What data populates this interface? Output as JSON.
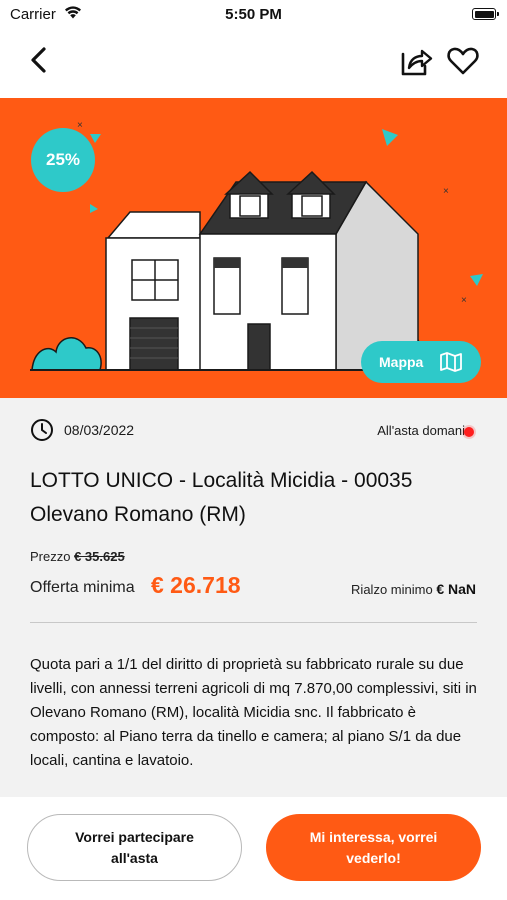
{
  "status_bar": {
    "carrier": "Carrier",
    "time": "5:50 PM",
    "icons": [
      "wifi-icon",
      "battery-icon"
    ]
  },
  "nav": {
    "icons": [
      "back-chevron-icon",
      "share-icon",
      "heart-icon"
    ]
  },
  "hero": {
    "discount": "25%",
    "map_label": "Mappa",
    "background_color": "#ff5a14",
    "accent_color": "#2ec9c9"
  },
  "listing": {
    "date": "08/03/2022",
    "auction_status": "All'asta domani",
    "title": "LOTTO UNICO - Località Micidia - 00035 Olevano Romano (RM)",
    "price_label": "Prezzo",
    "old_price": "€ 35.625",
    "min_offer_label": "Offerta minima",
    "min_offer_value": "€ 26.718",
    "min_raise_label": "Rialzo minimo",
    "min_raise_value": "€ NaN",
    "description": "Quota pari a 1/1 del diritto di proprietà su fabbricato rurale su due livelli, con annessi terreni agricoli di mq 7.870,00 complessivi, siti in Olevano Romano (RM), località Micidia snc. Il fabbricato è composto: al Piano terra da tinello e camera; al piano S/1 da due locali, cantina e lavatoio."
  },
  "actions": {
    "participate": "Vorrei partecipare all'asta",
    "interested": "Mi interessa, vorrei vederlo!"
  },
  "colors": {
    "primary": "#ff5a14",
    "teal": "#2ec9c9",
    "live": "#ff1e1e"
  }
}
